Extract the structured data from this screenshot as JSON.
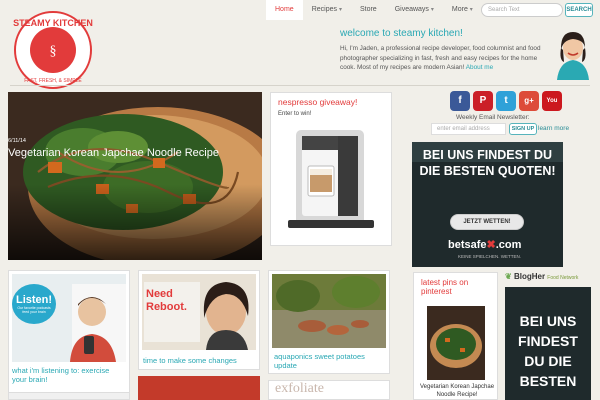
{
  "header": {
    "logo": {
      "arc_text": "STEAMY KITCHEN",
      "tagline": "FAST, FRESH, & SIMPLE"
    },
    "nav": [
      {
        "label": "Home",
        "active": true,
        "dropdown": false
      },
      {
        "label": "Recipes",
        "active": false,
        "dropdown": true
      },
      {
        "label": "Store",
        "active": false,
        "dropdown": false
      },
      {
        "label": "Giveaways",
        "active": false,
        "dropdown": true
      },
      {
        "label": "More",
        "active": false,
        "dropdown": true
      }
    ],
    "search": {
      "placeholder": "Search Text",
      "button": "SEARCH"
    },
    "welcome": {
      "title": "welcome to steamy kitchen!",
      "text": "Hi, I'm Jaden, a professional recipe developer, food columnist and food photographer specializing in fast, fresh and easy recipes for the home cook. Most of my recipes are modern Asian!",
      "link": "About me"
    }
  },
  "hero": {
    "date": "6/11/14",
    "title": "Vegetarian Korean Japchae Noodle Recipe"
  },
  "nespresso": {
    "title": "nespresso giveaway!",
    "enter": "Enter to win!"
  },
  "sidebar": {
    "social": [
      {
        "icon": "facebook-icon",
        "glyph": "f",
        "color": "#3b5998"
      },
      {
        "icon": "pinterest-icon",
        "glyph": "P",
        "color": "#cb2027"
      },
      {
        "icon": "twitter-icon",
        "glyph": "t",
        "color": "#2fa1d8"
      },
      {
        "icon": "google-plus-icon",
        "glyph": "g+",
        "color": "#dd4b39"
      },
      {
        "icon": "youtube-icon",
        "glyph": "You",
        "color": "#cc181e"
      }
    ],
    "newsletter_label": "Weekly Email Newsletter:",
    "email_placeholder": "enter email address",
    "signup": "SIGN UP",
    "learn_more": "learn more",
    "ad": {
      "line1": "BEI UNS FINDEST DU",
      "line2": "DIE BESTEN QUOTEN!",
      "button": "JETZT WETTEN!",
      "brand": "betsafe",
      "brand_suffix": ".com",
      "tagline": "KEINE SPIELCHEN. WETTEN."
    }
  },
  "tiles": [
    {
      "label": "what i'm listening to: exercise your brain!",
      "badge_title": "Listen!",
      "badge_sub": "Our favorite podcasts feed your brain"
    },
    {
      "label": "time to make some changes",
      "sign_line1": "Need",
      "sign_line2": "Reboot."
    },
    {
      "label": "aquaponics sweet potatoes update"
    }
  ],
  "bottom_row": {
    "exfoliate": "exfoliate"
  },
  "pins": {
    "title": "latest pins on pinterest",
    "caption": "Vegetarian Korean Japchae Noodle Recipe!"
  },
  "blogher": {
    "name": "BlogHer",
    "sub": "Food Network"
  },
  "ad2": {
    "text": "BEI UNS FINDEST DU DIE BESTEN"
  },
  "colors": {
    "accent_teal": "#2aa8b4",
    "accent_red": "#e23b3b",
    "background": "#f1efe9"
  }
}
